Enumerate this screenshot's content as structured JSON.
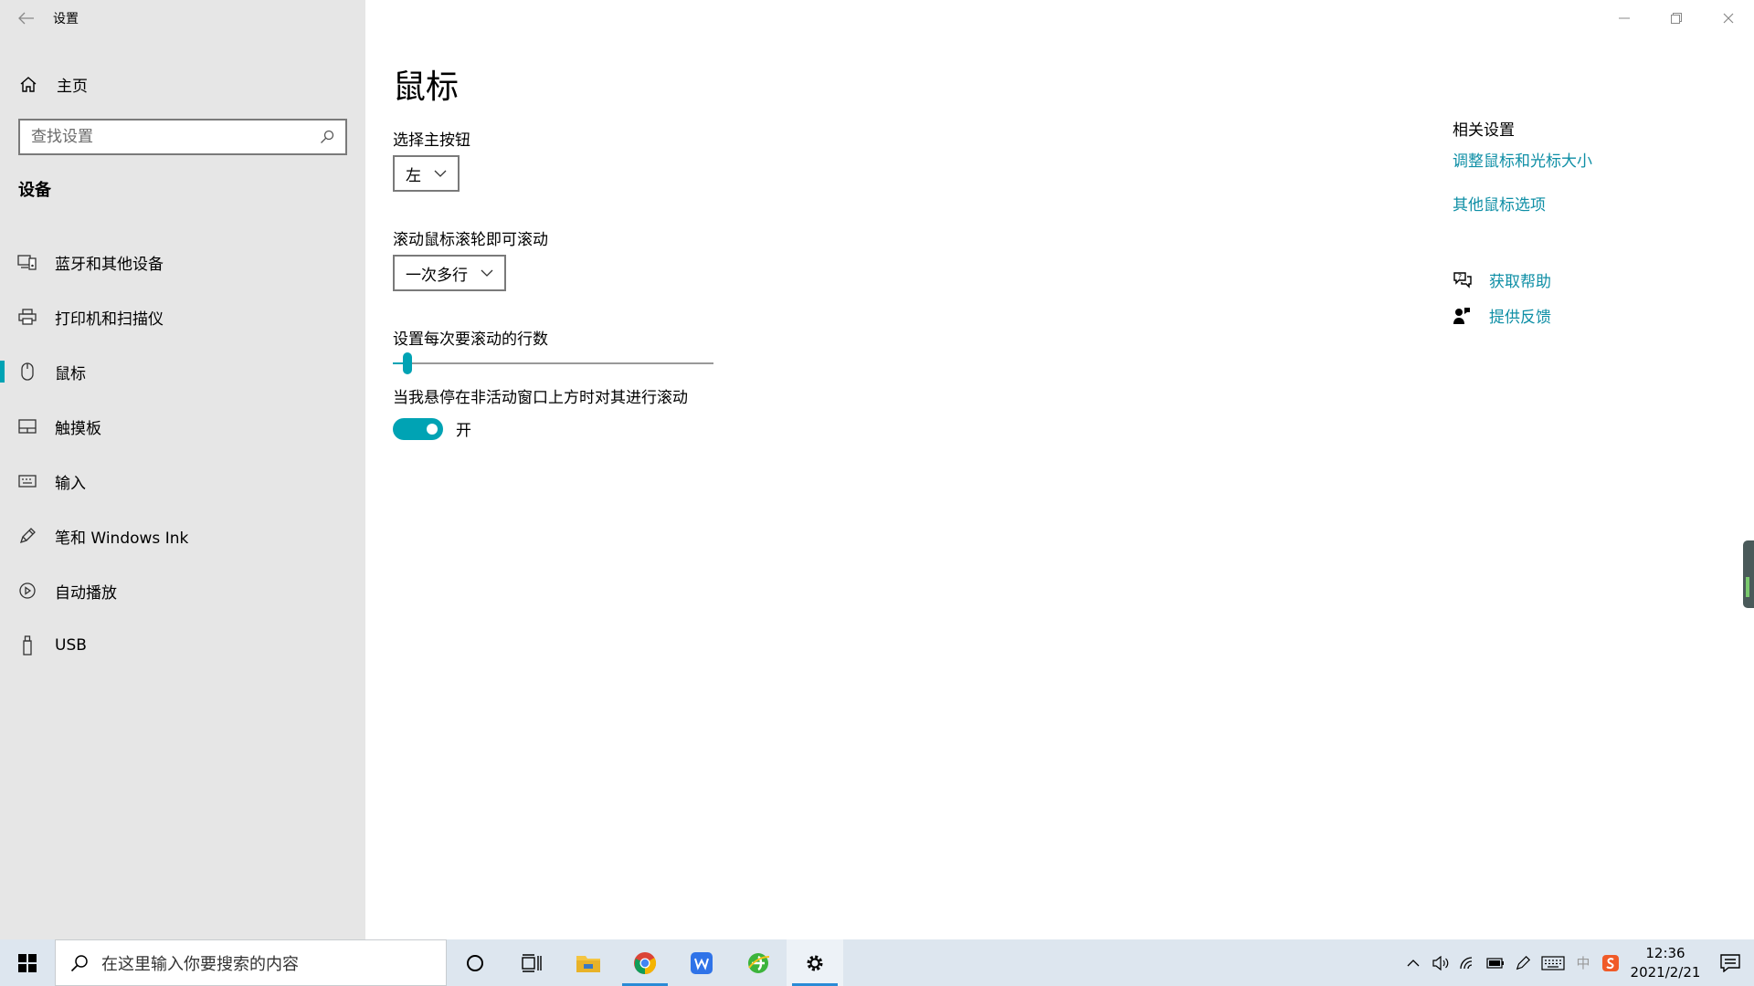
{
  "window": {
    "title": "设置"
  },
  "sidebar": {
    "home_label": "主页",
    "search_placeholder": "查找设置",
    "section": "设备",
    "items": [
      {
        "label": "蓝牙和其他设备",
        "icon": "bluetooth-devices-icon"
      },
      {
        "label": "打印机和扫描仪",
        "icon": "printer-icon"
      },
      {
        "label": "鼠标",
        "icon": "mouse-icon",
        "active": true
      },
      {
        "label": "触摸板",
        "icon": "touchpad-icon"
      },
      {
        "label": "输入",
        "icon": "keyboard-icon"
      },
      {
        "label": "笔和 Windows Ink",
        "icon": "pen-icon"
      },
      {
        "label": "自动播放",
        "icon": "autoplay-icon"
      },
      {
        "label": "USB",
        "icon": "usb-icon"
      }
    ]
  },
  "main": {
    "title": "鼠标",
    "primary_button": {
      "label": "选择主按钮",
      "value": "左"
    },
    "wheel_scroll": {
      "label": "滚动鼠标滚轮即可滚动",
      "value": "一次多行"
    },
    "lines_to_scroll": {
      "label": "设置每次要滚动的行数",
      "value": 3,
      "min": 1,
      "max": 100
    },
    "inactive_scroll": {
      "label": "当我悬停在非活动窗口上方时对其进行滚动",
      "state": "开",
      "on": true
    }
  },
  "related": {
    "header": "相关设置",
    "links": [
      "调整鼠标和光标大小",
      "其他鼠标选项"
    ],
    "help": "获取帮助",
    "feedback": "提供反馈"
  },
  "taskbar": {
    "search_placeholder": "在这里输入你要搜索的内容",
    "time": "12:36",
    "date": "2021/2/21",
    "ime": "中"
  },
  "colors": {
    "accent": "#00a3b4",
    "link": "#0f8fa6",
    "sidebar_bg": "#e6e6e6",
    "taskbar_bg": "#dde6ef"
  }
}
